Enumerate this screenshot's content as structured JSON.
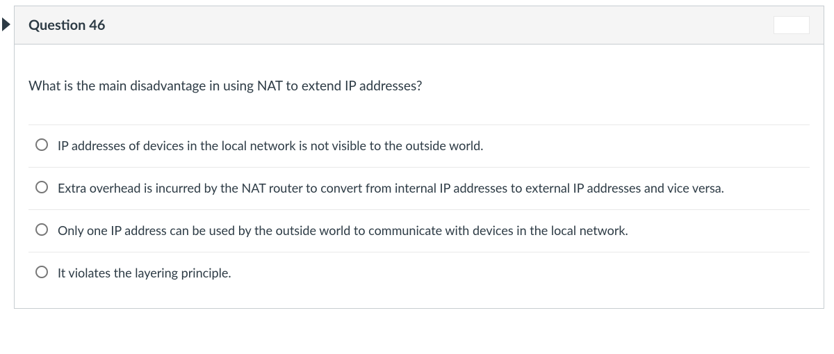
{
  "question": {
    "header": "Question 46",
    "prompt": "What is the main disadvantage in using NAT to extend IP addresses?",
    "answers": [
      "IP addresses of devices in the local network is not visible to the outside world.",
      "Extra overhead is incurred by the NAT router to convert from internal IP addresses to external IP addresses and vice versa.",
      "Only one IP address can be used by the outside world to communicate with devices in the local network.",
      "It violates the layering principle."
    ]
  }
}
